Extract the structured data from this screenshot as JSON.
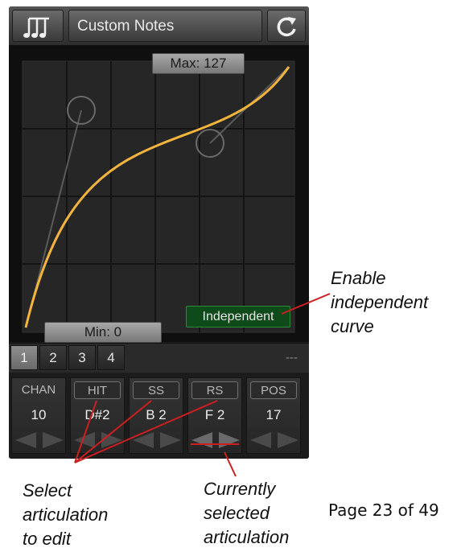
{
  "app": {
    "title": "Custom Notes",
    "icons": {
      "notes": "music-notes-icon",
      "refresh": "refresh-icon"
    }
  },
  "graph": {
    "max_label": "Max: 127",
    "min_label": "Min: 0",
    "independent_label": "Independent",
    "curve_color": "#f2b43c"
  },
  "tabs": {
    "items": [
      {
        "label": "1",
        "active": true
      },
      {
        "label": "2",
        "active": false
      },
      {
        "label": "3",
        "active": false
      },
      {
        "label": "4",
        "active": false
      }
    ],
    "right_text": "---"
  },
  "articulations": [
    {
      "label": "CHAN",
      "value": "10"
    },
    {
      "label": "HIT",
      "value": "D#2"
    },
    {
      "label": "SS",
      "value": "B 2"
    },
    {
      "label": "RS",
      "value": "F 2"
    },
    {
      "label": "POS",
      "value": "17"
    }
  ],
  "annotations": {
    "enable": [
      "Enable",
      "independent",
      "curve"
    ],
    "select": [
      "Select",
      "articulation",
      "to edit"
    ],
    "current": [
      "Currently",
      "selected",
      "articulation"
    ],
    "line_color": "#cc1f1f"
  },
  "page": "Page 23 of 49"
}
